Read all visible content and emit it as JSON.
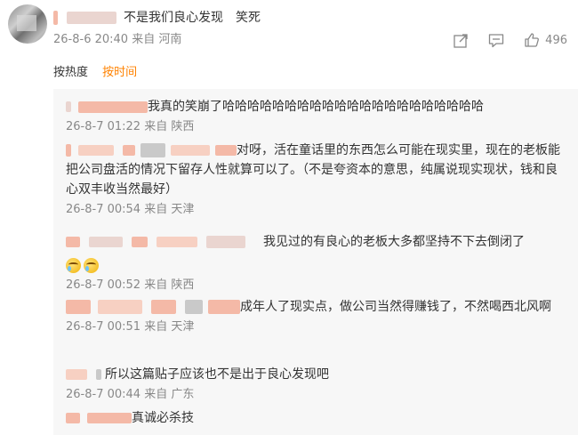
{
  "post": {
    "title_text": "不是我们良心发现　笑死",
    "meta": "26-8-6 20:40 来自 河南",
    "actions": {
      "share_icon": "share-icon",
      "comment_icon": "comment-icon",
      "like_icon": "thumbs-up-icon",
      "like_count": "496"
    }
  },
  "sort": {
    "by_hot": "按热度",
    "by_time": "按时间",
    "active": "按时间",
    "active_color": "#ff8200"
  },
  "comments": [
    {
      "text": "我真的笑崩了哈哈哈哈哈哈哈哈哈哈哈哈哈哈哈哈哈哈哈哈哈",
      "meta": "26-8-7 01:22 来自 陕西"
    },
    {
      "text": "对呀，活在童话里的东西怎么可能在现实里，现在的老板能把公司盘活的情况下留存人性就算可以了。（不是夸资本的意思，纯属说现实现状，钱和良心双丰收当然最好）",
      "meta": "26-8-7 00:54 来自 天津"
    },
    {
      "text": "我见过的有良心的老板大多都坚持不下去倒闭了",
      "meta": "26-8-7 00:52 来自 陕西"
    },
    {
      "text": "成年人了现实点，做公司当然得赚钱了，不然喝西北风啊",
      "meta": "26-8-7 00:51 来自 天津"
    },
    {
      "text": "所以这篇贴子应该也不是出于良心发现吧",
      "meta": "26-8-7 00:44 来自 广东"
    },
    {
      "text": "真诚必杀技",
      "meta": ""
    }
  ],
  "emoji_name": "crying-face-emoji"
}
